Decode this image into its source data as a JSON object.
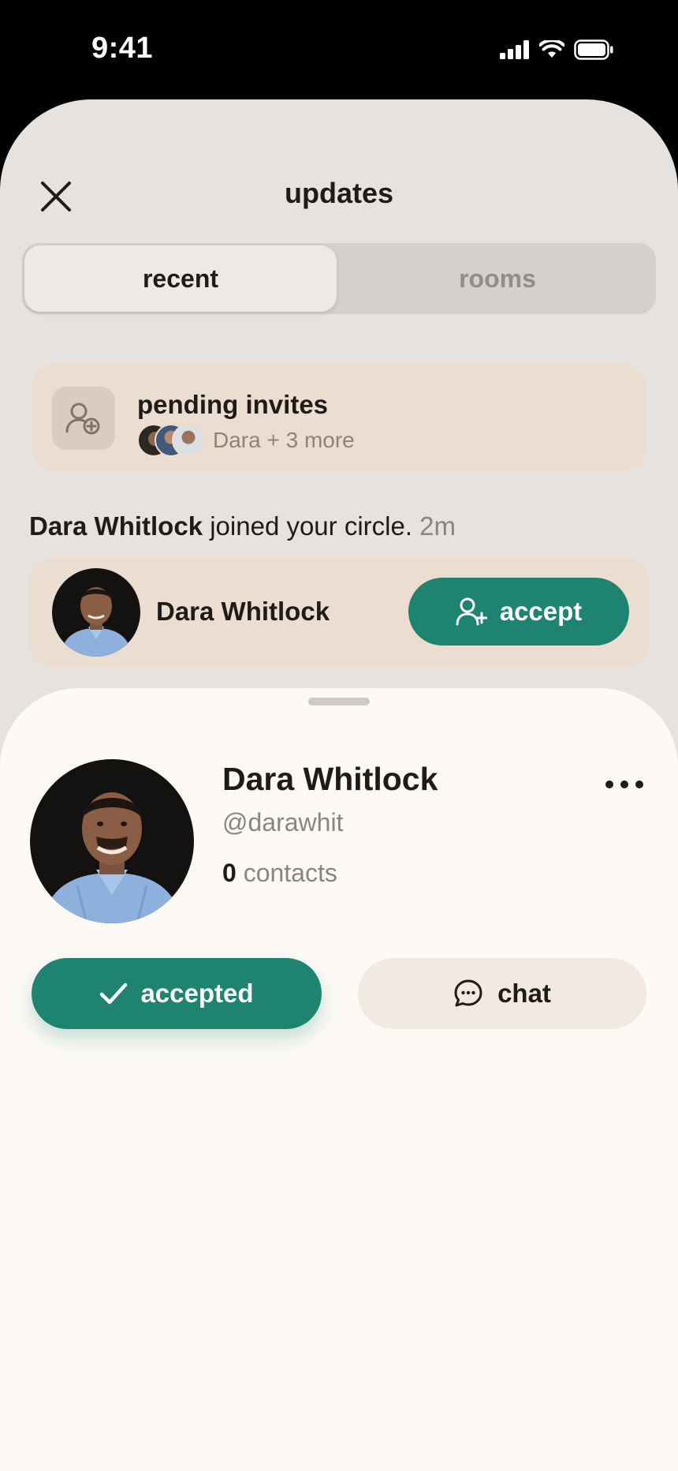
{
  "status_bar": {
    "time": "9:41"
  },
  "header": {
    "title": "updates"
  },
  "tabs": [
    {
      "label": "recent",
      "active": true
    },
    {
      "label": "rooms",
      "active": false
    }
  ],
  "invites": {
    "title": "pending invites",
    "subtitle": "Dara + 3 more"
  },
  "activity": {
    "name": "Dara Whitlock",
    "text": " joined your circle.",
    "time": "2m"
  },
  "person_card": {
    "name": "Dara Whitlock",
    "accept_label": "accept"
  },
  "profile": {
    "name": "Dara Whitlock",
    "handle": "@darawhit",
    "contacts_count": "0",
    "contacts_label": "contacts",
    "accepted_label": "accepted",
    "chat_label": "chat"
  },
  "colors": {
    "accent": "#1e8370",
    "card": "#ebddcf",
    "background": "#e5e2df",
    "sheet": "#fdfaf6"
  }
}
